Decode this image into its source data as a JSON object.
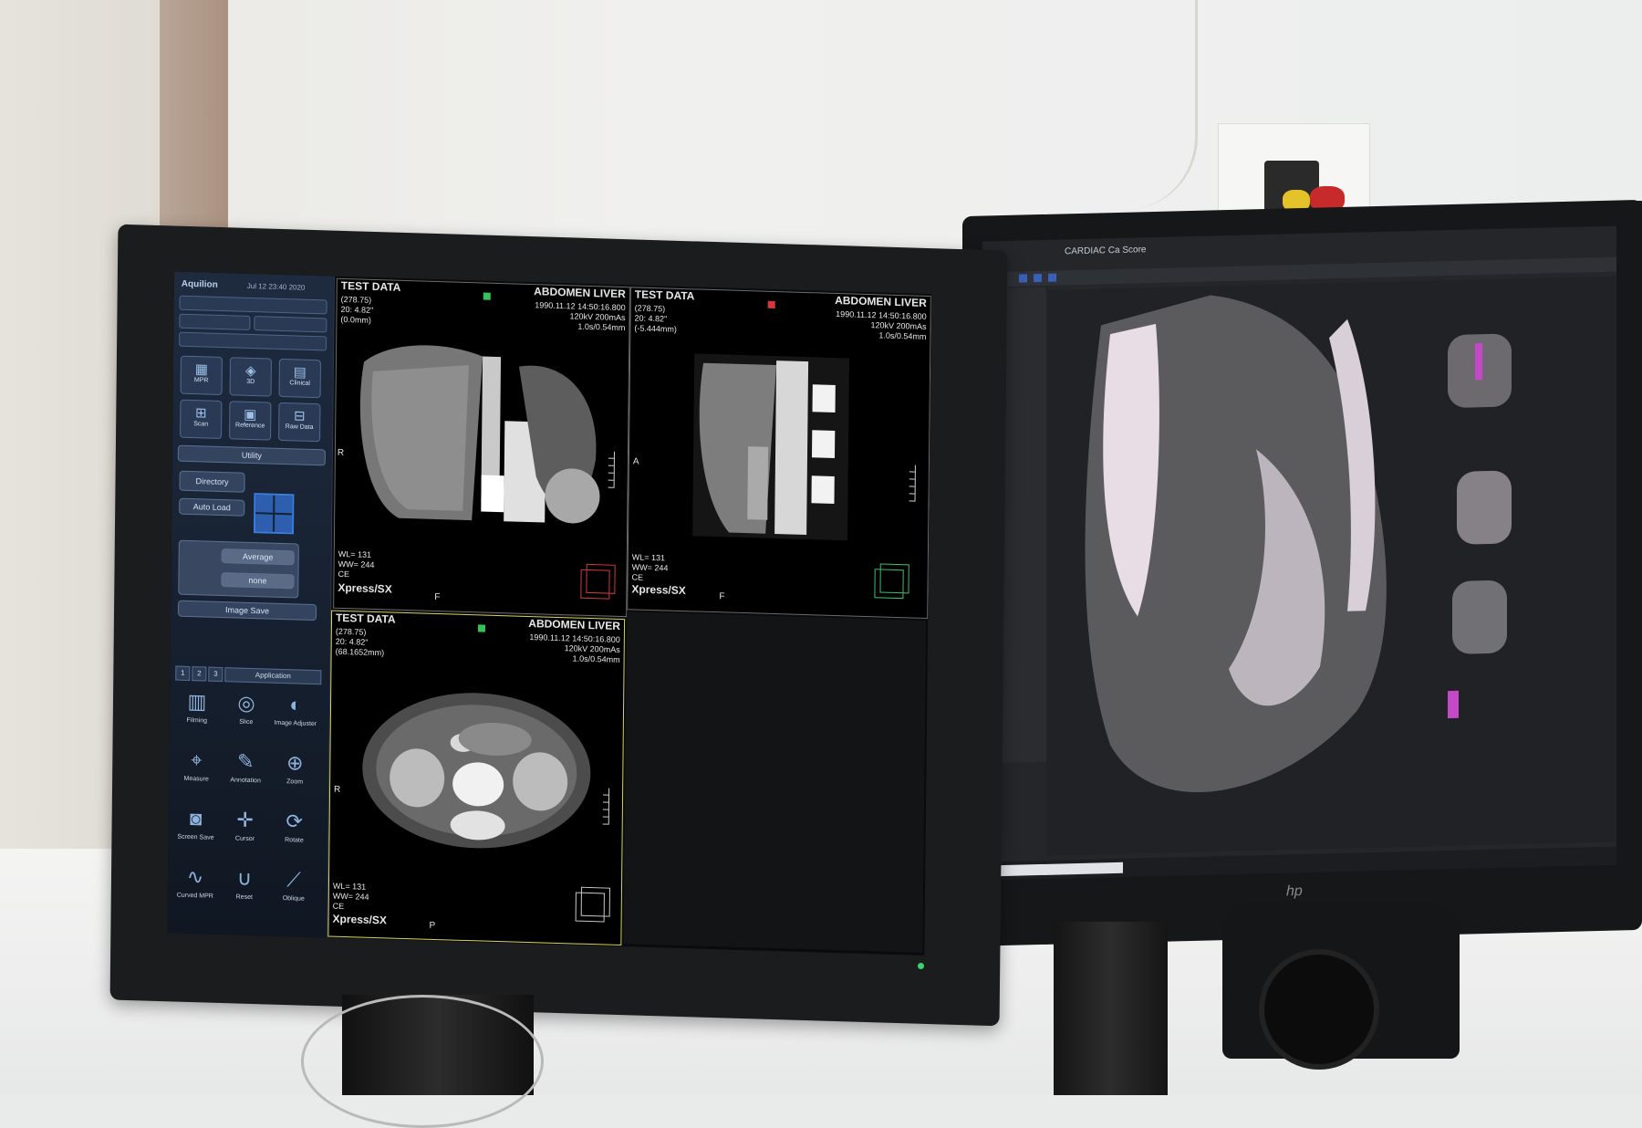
{
  "left_monitor": {
    "panel": {
      "app_title": "Aquilion",
      "app_date": "Jul 12 23:40 2020",
      "buttons_row1": [
        "MPR",
        "3D",
        "Clinical"
      ],
      "buttons_row2": [
        "Scan",
        "Reference",
        "Raw Data"
      ],
      "utility": "Utility",
      "directory": "Directory",
      "auto_load": "Auto Load",
      "average_label": "Average",
      "none_label": "none",
      "image_save": "Image Save",
      "tabs": [
        "1",
        "2",
        "3"
      ],
      "application": "Application",
      "tools": [
        {
          "label": "Filming",
          "icon": "filming-icon"
        },
        {
          "label": "Slice",
          "icon": "slice-icon"
        },
        {
          "label": "Image Adjuster",
          "icon": "image-adjust-icon"
        },
        {
          "label": "Measure",
          "icon": "measure-icon"
        },
        {
          "label": "Annotation",
          "icon": "annotation-icon"
        },
        {
          "label": "Zoom",
          "icon": "zoom-icon"
        },
        {
          "label": "Screen Save",
          "icon": "camera-icon"
        },
        {
          "label": "Cursor",
          "icon": "crosshair-icon"
        },
        {
          "label": "Rotate",
          "icon": "rotate-icon"
        },
        {
          "label": "Curved MPR",
          "icon": "curved-mpr-icon"
        },
        {
          "label": "Reset",
          "icon": "reset-icon"
        },
        {
          "label": "Oblique",
          "icon": "oblique-icon"
        }
      ]
    },
    "viewports": [
      {
        "name": "TEST DATA",
        "study": "ABDOMEN LIVER",
        "left_info": [
          "(278.75)",
          "20: 4.82\"",
          "(0.0mm)"
        ],
        "right_info": [
          "1990.11.12 14:50:16.800",
          "120kV 200mAs",
          "1.0s/0.54mm"
        ],
        "wl": "WL= 131",
        "ww": "WW= 244",
        "ce": "CE",
        "system": "Xpress/SX",
        "orient_bottom": "F",
        "orient_left": "R"
      },
      {
        "name": "TEST DATA",
        "study": "ABDOMEN LIVER",
        "left_info": [
          "(278.75)",
          "20: 4.82\"",
          "(-5.444mm)"
        ],
        "right_info": [
          "1990.11.12 14:50:16.800",
          "120kV 200mAs",
          "1.0s/0.54mm"
        ],
        "wl": "WL= 131",
        "ww": "WW= 244",
        "ce": "CE",
        "system": "Xpress/SX",
        "orient_bottom": "F",
        "orient_left": "A"
      },
      {
        "name": "TEST DATA",
        "study": "ABDOMEN LIVER",
        "left_info": [
          "(278.75)",
          "20: 4.82\"",
          "(68.1652mm)"
        ],
        "right_info": [
          "1990.11.12 14:50:16.800",
          "120kV 200mAs",
          "1.0s/0.54mm"
        ],
        "wl": "WL= 131",
        "ww": "WW= 244",
        "ce": "CE",
        "system": "Xpress/SX",
        "orient_bottom": "P",
        "orient_left": "R"
      }
    ]
  },
  "right_monitor": {
    "title": "CARDIAC Ca Score"
  },
  "colors": {
    "active_viewport_border": "#d9d25a",
    "panel_bg": "#1e2b3f",
    "accent_blue": "#3a7ee0"
  }
}
